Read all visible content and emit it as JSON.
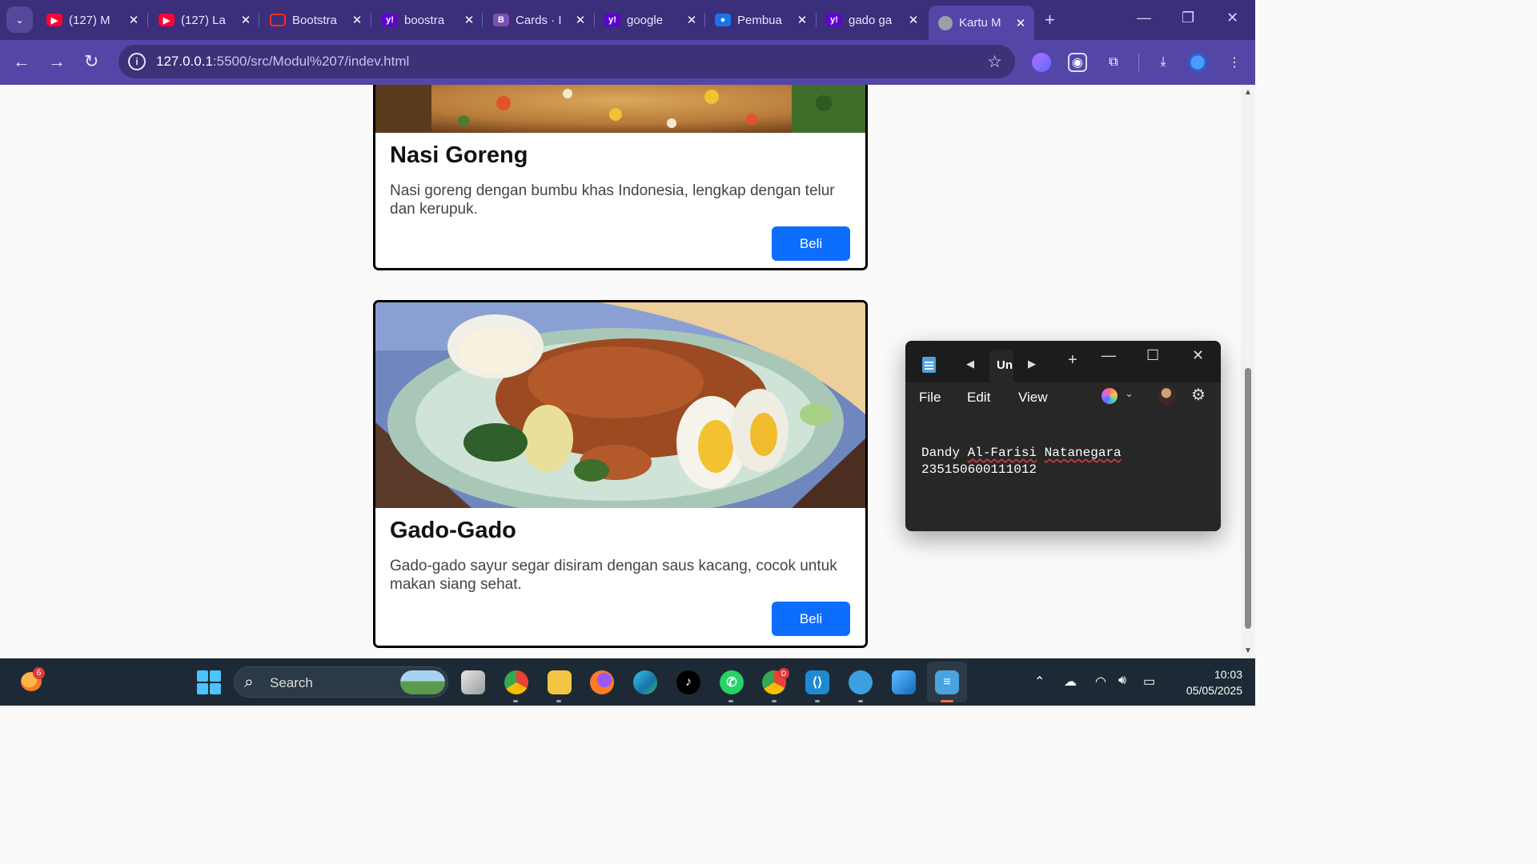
{
  "browser": {
    "tabs": [
      {
        "label": "(127) M",
        "icon": "youtube-icon",
        "color": "#ff0033"
      },
      {
        "label": "(127) La",
        "icon": "youtube-icon",
        "color": "#ff0033"
      },
      {
        "label": "Bootstra",
        "icon": "laravel-icon",
        "color": "#ff2d20"
      },
      {
        "label": "boostra",
        "icon": "yahoo-icon",
        "color": "#6001d2"
      },
      {
        "label": "Cards · I",
        "icon": "bootstrap-icon",
        "color": "#7952b3"
      },
      {
        "label": "google",
        "icon": "yahoo-icon",
        "color": "#6001d2"
      },
      {
        "label": "Pembua",
        "icon": "contact-icon",
        "color": "#1a73e8"
      },
      {
        "label": "gado ga",
        "icon": "yahoo-icon",
        "color": "#6001d2"
      },
      {
        "label": "Kartu M",
        "icon": "globe-icon",
        "color": "#9aa0a6"
      }
    ],
    "url_host": "127.0.0.1",
    "url_path": ":5500/src/Modul%207/indev.html"
  },
  "cards": [
    {
      "title": "Nasi Goreng",
      "description": "Nasi goreng dengan bumbu khas Indonesia, lengkap dengan telur dan kerupuk.",
      "button": "Beli"
    },
    {
      "title": "Gado-Gado",
      "description": "Gado-gado sayur segar disiram dengan saus kacang, cocok untuk makan siang sehat.",
      "button": "Beli"
    }
  ],
  "notepad": {
    "tab_label": "Un",
    "menu": {
      "file": "File",
      "edit": "Edit",
      "view": "View"
    },
    "line1_a": "Dandy ",
    "line1_b": "Al-Farisi",
    "line1_c": " ",
    "line1_d": "Natanegara",
    "line2": "235150600111012"
  },
  "taskbar": {
    "search_placeholder": "Search",
    "weather_badge": "6",
    "chrome_badge": "D",
    "time": "10:03",
    "date": "05/05/2025"
  },
  "colors": {
    "browser_frame": "#3b2e7a",
    "browser_toolbar": "#5446a7",
    "primary_button": "#0d6efd",
    "taskbar": "#1d2a35"
  }
}
